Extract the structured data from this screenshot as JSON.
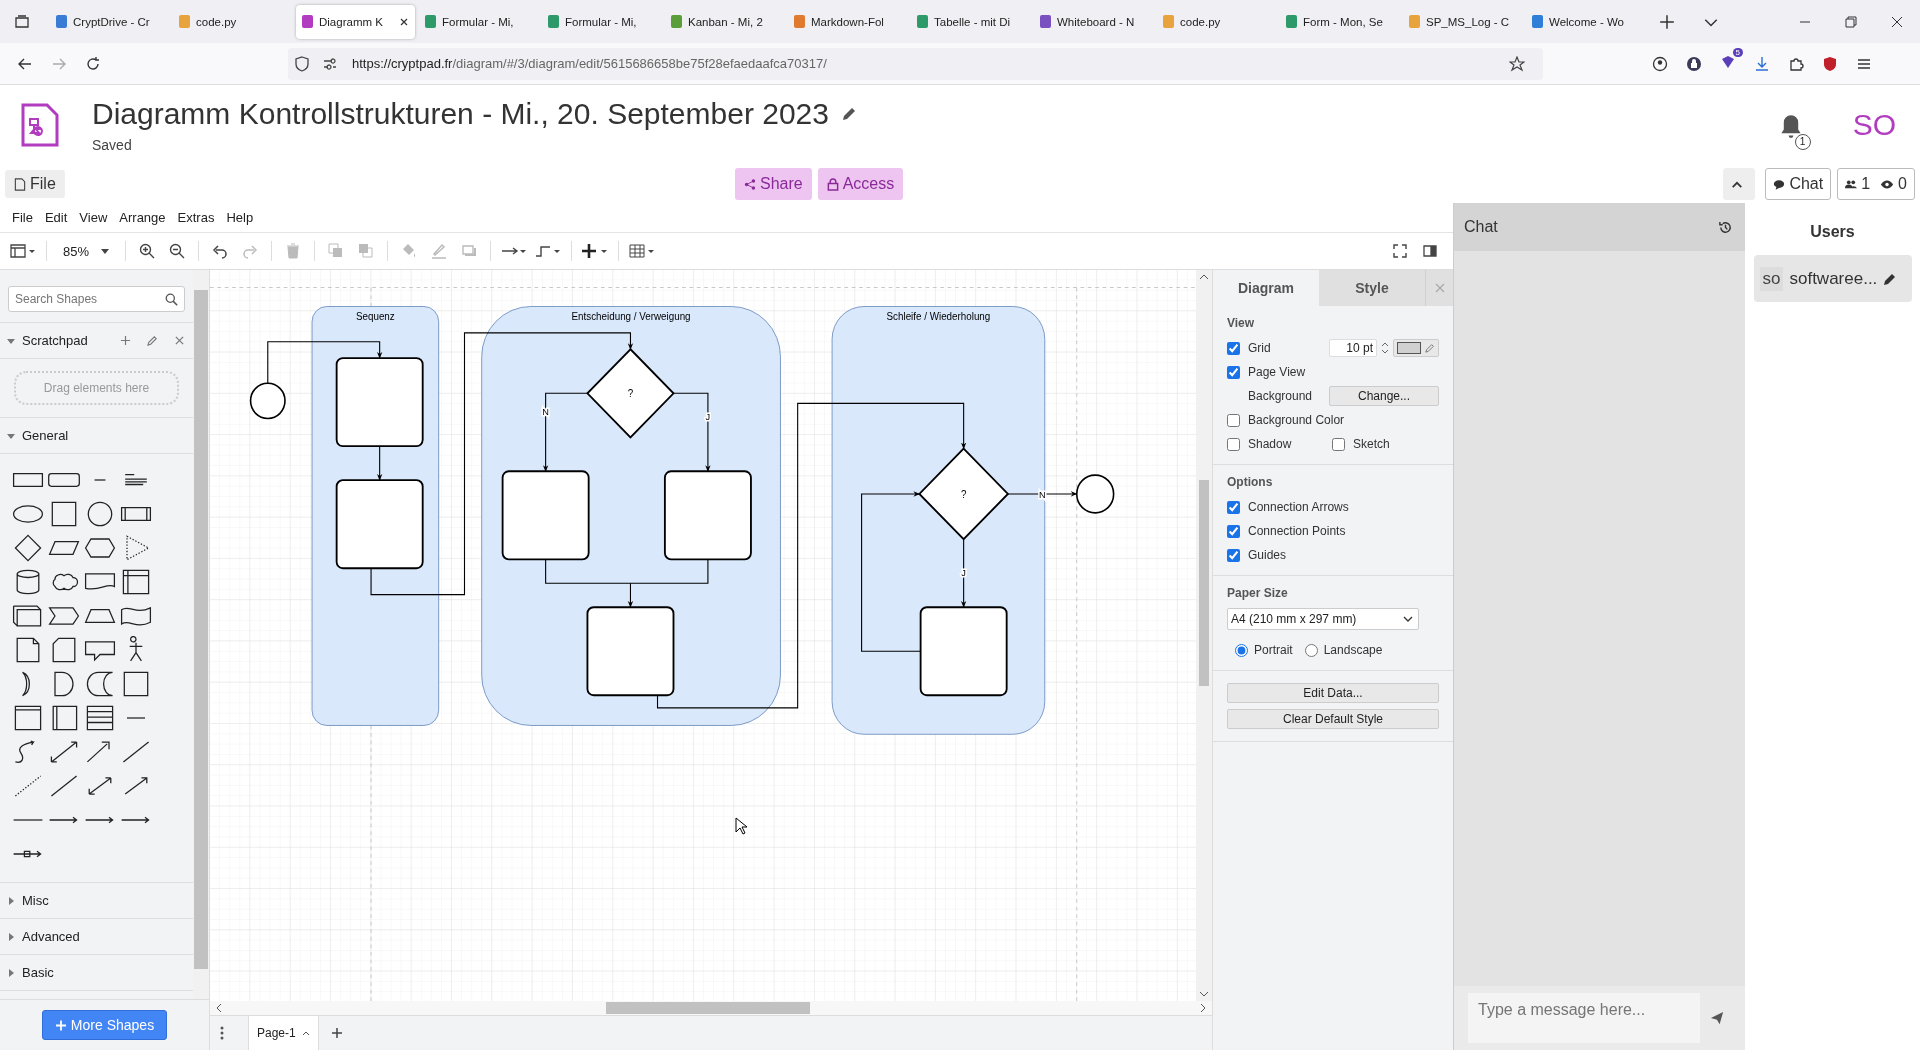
{
  "browser": {
    "tabs": [
      {
        "title": "CryptDrive - Cr",
        "selected": false,
        "color": "#3a7bd5"
      },
      {
        "title": "code.py",
        "selected": false,
        "color": "#e8a33d"
      },
      {
        "title": "Diagramm K",
        "selected": true,
        "color": "#b23cc0"
      },
      {
        "title": "Formular - Mi,",
        "selected": false,
        "color": "#2e9a6a"
      },
      {
        "title": "Formular - Mi,",
        "selected": false,
        "color": "#2e9a6a"
      },
      {
        "title": "Kanban - Mi, 2",
        "selected": false,
        "color": "#5a9e3a"
      },
      {
        "title": "Markdown-Fol",
        "selected": false,
        "color": "#e07a2e"
      },
      {
        "title": "Tabelle - mit Di",
        "selected": false,
        "color": "#2e9a6a"
      },
      {
        "title": "Whiteboard - N",
        "selected": false,
        "color": "#7a4fc0"
      },
      {
        "title": "code.py",
        "selected": false,
        "color": "#e8a33d"
      },
      {
        "title": "Form - Mon, Se",
        "selected": false,
        "color": "#2e9a6a"
      },
      {
        "title": "SP_MS_Log - C",
        "selected": false,
        "color": "#e8a33d"
      },
      {
        "title": "Welcome - Wo",
        "selected": false,
        "color": "#2f7fd8"
      }
    ],
    "url_host": "https://cryptpad.fr",
    "url_path": "/diagram/#/3/diagram/edit/5615686658be75f28efaedaafca70317/",
    "extension_badge": "5"
  },
  "app": {
    "title": "Diagramm Kontrollstrukturen - Mi., 20. September 2023",
    "status": "Saved",
    "notifications": "1",
    "avatar": "SO"
  },
  "bar": {
    "file": "File",
    "share": "Share",
    "access": "Access",
    "chat": "Chat",
    "users_count": "1",
    "viewers_count": "0"
  },
  "menu": [
    "File",
    "Edit",
    "View",
    "Arrange",
    "Extras",
    "Help"
  ],
  "zoom": "85%",
  "sidebar": {
    "search_placeholder": "Search Shapes",
    "drop_hint": "Drag elements here",
    "more_button": "More Shapes",
    "sections": [
      {
        "title": "Scratchpad",
        "expanded": true,
        "kind": "scratchpad"
      },
      {
        "title": "General",
        "expanded": true,
        "kind": "palette"
      },
      {
        "title": "Misc",
        "expanded": false,
        "kind": "palette"
      },
      {
        "title": "Advanced",
        "expanded": false,
        "kind": "palette"
      },
      {
        "title": "Basic",
        "expanded": false,
        "kind": "palette"
      }
    ]
  },
  "diagram": {
    "lanes": [
      "Sequenz",
      "Entscheidung / Verweigung",
      "Schleife / Wiederholung"
    ],
    "decision_labels": [
      "?",
      "?"
    ],
    "edge_labels": [
      "N",
      "J",
      "N",
      "J"
    ]
  },
  "format_panel": {
    "tabs": [
      {
        "label": "Diagram",
        "selected": true
      },
      {
        "label": "Style",
        "selected": false
      }
    ],
    "view_title": "View",
    "grid": {
      "label": "Grid",
      "checked": true,
      "size": "10 pt"
    },
    "page_view": {
      "label": "Page View",
      "checked": true
    },
    "background": {
      "label": "Background",
      "button": "Change..."
    },
    "background_color": {
      "label": "Background Color",
      "checked": false
    },
    "shadow": {
      "label": "Shadow",
      "checked": false
    },
    "sketch": {
      "label": "Sketch",
      "checked": false
    },
    "options_title": "Options",
    "options": [
      {
        "label": "Connection Arrows",
        "checked": true
      },
      {
        "label": "Connection Points",
        "checked": true
      },
      {
        "label": "Guides",
        "checked": true
      }
    ],
    "paper_title": "Paper Size",
    "paper_size": "A4 (210 mm x 297 mm)",
    "orientations": [
      {
        "label": "Portrait",
        "selected": true
      },
      {
        "label": "Landscape",
        "selected": false
      }
    ],
    "buttons": [
      "Edit Data...",
      "Clear Default Style"
    ]
  },
  "pages": [
    {
      "label": "Page-1",
      "selected": true
    }
  ],
  "chat": {
    "title": "Chat",
    "placeholder": "Type a message here..."
  },
  "users": {
    "title": "Users",
    "list": [
      {
        "initials": "so",
        "name": "softwaree..."
      }
    ]
  }
}
